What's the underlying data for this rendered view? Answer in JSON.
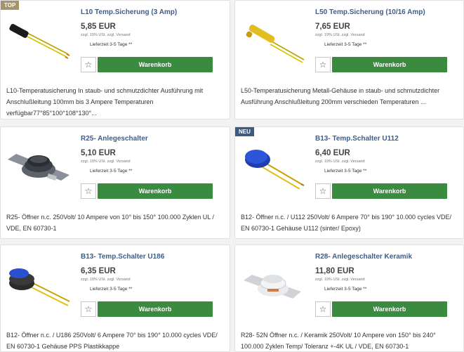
{
  "products": [
    {
      "badge": "TOP",
      "badge_color": "#a6946a",
      "title": "L10 Temp.Sicherung (3 Amp)",
      "price": "5,85 EUR",
      "vat": "zzgl. 19% USt. zzgl. Versand",
      "delivery": "Lieferzeit 3-5 Tage **",
      "cart_label": "Warenkorb",
      "wishlist_icon": "star-icon",
      "description": "L10-Temperatusicherung In staub- und schmutzdichter Ausführung mit Anschlußleitung 100mm bis 3 Ampere Temperaturen verfügbar77°85°100°108°130°..."
    },
    {
      "badge": "",
      "title": "L50 Temp.Sicherung (10/16 Amp)",
      "price": "7,65 EUR",
      "vat": "zzgl. 19% USt. zzgl. Versand",
      "delivery": "Lieferzeit 3-5 Tage **",
      "cart_label": "Warenkorb",
      "wishlist_icon": "star-icon",
      "description": "L50-Temperatusicherung Metall-Gehäuse in staub- und schmutzdichter Ausführung Anschlußleitung 200mm verschieden Temperaturen ..."
    },
    {
      "badge": "",
      "title": "R25- Anlegeschalter",
      "price": "5,10 EUR",
      "vat": "zzgl. 19% USt. zzgl. Versand",
      "delivery": "Lieferzeit 3-5 Tage **",
      "cart_label": "Warenkorb",
      "wishlist_icon": "star-icon",
      "description": "R25- Öffner n.c. 250Volt/ 10 Ampere von 10° bis 150° 100.000 Zyklen UL / VDE, EN 60730-1"
    },
    {
      "badge": "NEU",
      "badge_color": "#3d5a80",
      "title": "B13- Temp.Schalter U112",
      "price": "6,40 EUR",
      "vat": "zzgl. 19% USt. zzgl. Versand",
      "delivery": "Lieferzeit 3-5 Tage **",
      "cart_label": "Warenkorb",
      "wishlist_icon": "star-icon",
      "description": "B12- Öffner n.c. / U112 250Volt/ 6 Ampere 70° bis 190° 10.000 cycles VDE/ EN 60730-1 Gehäuse U112 (sinter/ Epoxy)"
    },
    {
      "badge": "",
      "title": "B13- Temp.Schalter U186",
      "price": "6,35 EUR",
      "vat": "zzgl. 19% USt. zzgl. Versand",
      "delivery": "Lieferzeit 3-5 Tage **",
      "cart_label": "Warenkorb",
      "wishlist_icon": "star-icon",
      "description": "B12- Öffner n.c. / U186 250Volt/ 6 Ampere 70° bis 190° 10.000 cycles VDE/ EN 60730-1 Gehäuse PPS Plastikkappe"
    },
    {
      "badge": "",
      "title": "R28- Anlegeschalter Keramik",
      "price": "11,80 EUR",
      "vat": "zzgl. 19% USt. zzgl. Versand",
      "delivery": "Lieferzeit 3-5 Tage **",
      "cart_label": "Warenkorb",
      "wishlist_icon": "star-icon",
      "description": "R28- 52N Öffner n.c. / Keramik 250Volt/ 10 Ampere von 150° bis 240° 100.000 Zyklen Temp/ Toleranz +-4K UL / VDE, EN 60730-1"
    }
  ],
  "colors": {
    "title": "#3c5d8f",
    "cart_button": "#3a8a3f"
  }
}
